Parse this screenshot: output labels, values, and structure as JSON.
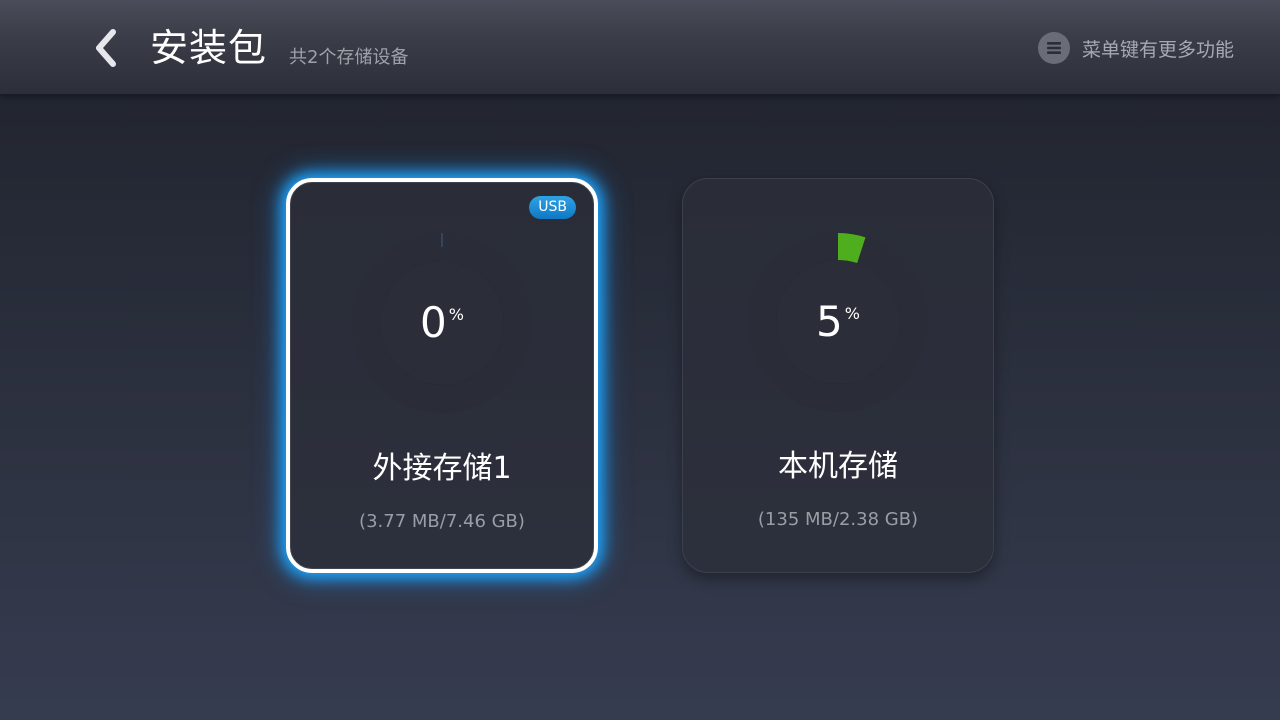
{
  "header": {
    "title": "安装包",
    "subtitle": "共2个存储设备",
    "menu_hint": "菜单键有更多功能",
    "back_icon": "chevron-left-icon",
    "menu_icon": "menu-icon"
  },
  "storage": [
    {
      "name": "外接存储1",
      "percent": "0",
      "percent_symbol": "%",
      "usage": "(3.77 MB/7.46 GB)",
      "badge": "USB",
      "usage_fraction": 0.0,
      "selected": true
    },
    {
      "name": "本机存储",
      "percent": "5",
      "percent_symbol": "%",
      "usage": "(135 MB/2.38 GB)",
      "usage_fraction": 0.05,
      "selected": false
    }
  ],
  "colors": {
    "selection_glow": "#1ca7ff",
    "usage_arc": "#4fae1e",
    "badge": "#1a86d2"
  }
}
